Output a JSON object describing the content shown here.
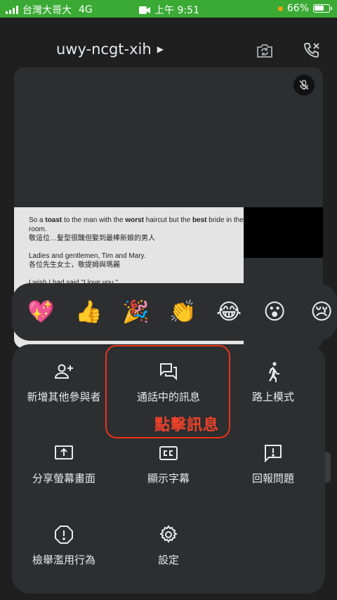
{
  "status_bar": {
    "carrier": "台灣大哥大",
    "network": "4G",
    "time": "上午 9:51",
    "battery": "66%",
    "battery_level": 0.66
  },
  "header": {
    "room_code": "uwy-ncgt-xih",
    "icons": [
      "camera-flip-icon",
      "call-end-icon"
    ]
  },
  "shared_screen": {
    "lines": [
      "So a toast to the man with the worst haircut but the best bride in the room.",
      "敬這位…髮型很醜但娶到最棒新娘的男人",
      "Ladies and gentlemen, Tim and Mary.",
      "各位先生女士，敬提姆與瑪麗",
      "I wish I had said \"I love you.\""
    ]
  },
  "reactions": [
    "💖",
    "👍",
    "🎉",
    "👏",
    "😂",
    "😮",
    "😢"
  ],
  "menu": {
    "add_others": "新增其他參與者",
    "in_call_messages": "通話中的訊息",
    "driving_mode": "路上模式",
    "share_screen": "分享螢幕畫面",
    "captions": "顯示字幕",
    "report_problem": "回報問題",
    "report_abuse": "檢舉濫用行為",
    "settings": "設定"
  },
  "annotation": "點擊訊息",
  "colors": {
    "background": "#1f1f1f",
    "sheet": "#2d2e30",
    "status_bar": "#3aaa35",
    "highlight": "#e8341c"
  }
}
